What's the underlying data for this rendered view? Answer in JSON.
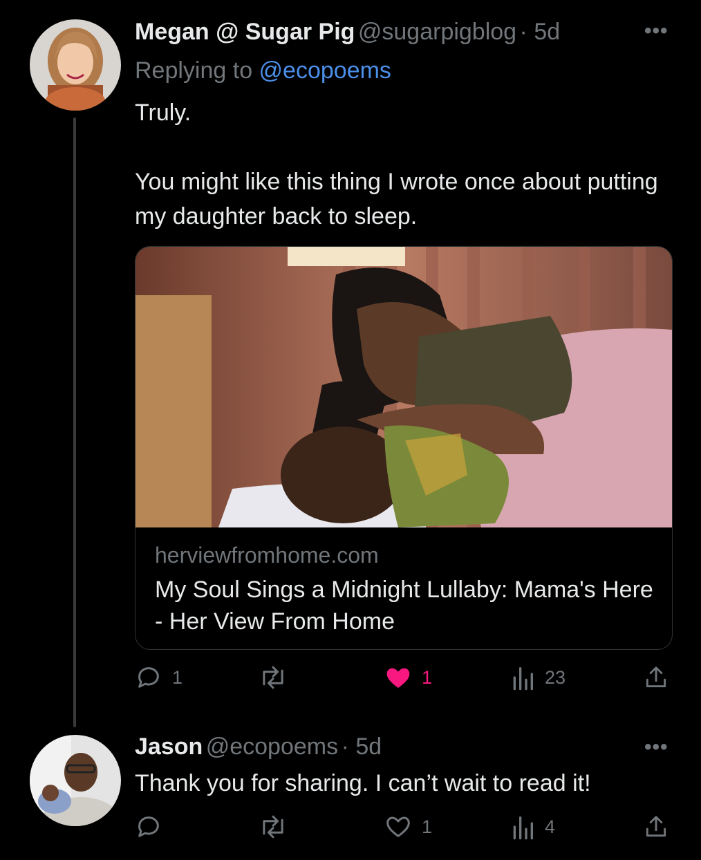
{
  "tweets": [
    {
      "display_name": "Megan @ Sugar Pig",
      "handle": "@sugarpigblog",
      "time": "· 5d",
      "reply_prefix": "Replying to ",
      "reply_to": "@ecopoems",
      "text_1": "Truly.",
      "text_2": "You might like this thing I wrote once about putting my daughter back to sleep.",
      "card": {
        "domain": "herviewfromhome.com",
        "title": "My Soul Sings a Midnight Lullaby: Mama's Here - Her View From Home"
      },
      "actions": {
        "replies": "1",
        "retweets": "",
        "likes": "1",
        "views": "23"
      },
      "liked": true
    },
    {
      "display_name": "Jason",
      "handle": "@ecopoems",
      "time": "· 5d",
      "text": "Thank you for sharing. I can’t wait to read it!",
      "actions": {
        "replies": "",
        "retweets": "",
        "likes": "1",
        "views": "4"
      },
      "liked": false
    }
  ],
  "icons": [
    "more-icon",
    "reply-icon",
    "retweet-icon",
    "like-icon",
    "views-icon",
    "share-icon"
  ],
  "colors": {
    "background": "#000000",
    "text": "#e7e9ea",
    "muted": "#71767b",
    "link": "#4b8fe8",
    "like": "#f91880"
  }
}
